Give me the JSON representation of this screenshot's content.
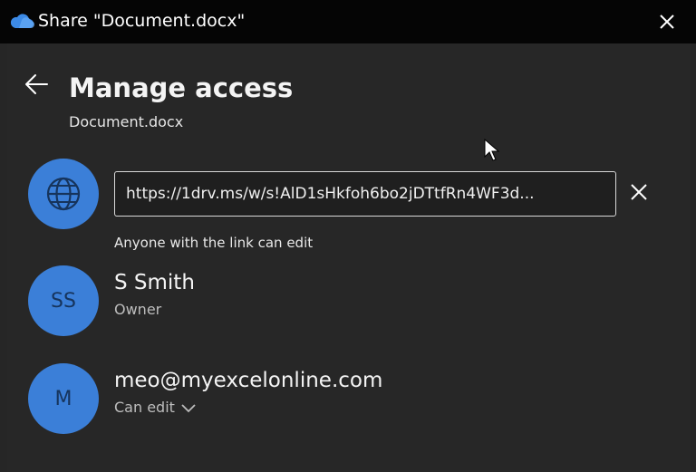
{
  "window": {
    "title": "Share \"Document.docx\"",
    "icons": {
      "app": "onedrive-cloud-icon",
      "close": "close-icon"
    }
  },
  "header": {
    "title": "Manage access",
    "subtitle": "Document.docx",
    "back_icon": "back-arrow-icon"
  },
  "link": {
    "icon": "globe-icon",
    "url": "https://1drv.ms/w/s!AlD1sHkfoh6bo2jDTtfRn4WF3d...",
    "description": "Anyone with the link can edit",
    "remove_icon": "close-icon"
  },
  "people": [
    {
      "initials": "SS",
      "name": "S Smith",
      "role": "Owner"
    },
    {
      "initials": "M",
      "name": "meo@myexcelonline.com",
      "role": "Can edit"
    }
  ],
  "colors": {
    "titlebar": "#050505",
    "background": "#272727",
    "avatar": "#3b7fd8",
    "avatar_text": "#16345c"
  }
}
